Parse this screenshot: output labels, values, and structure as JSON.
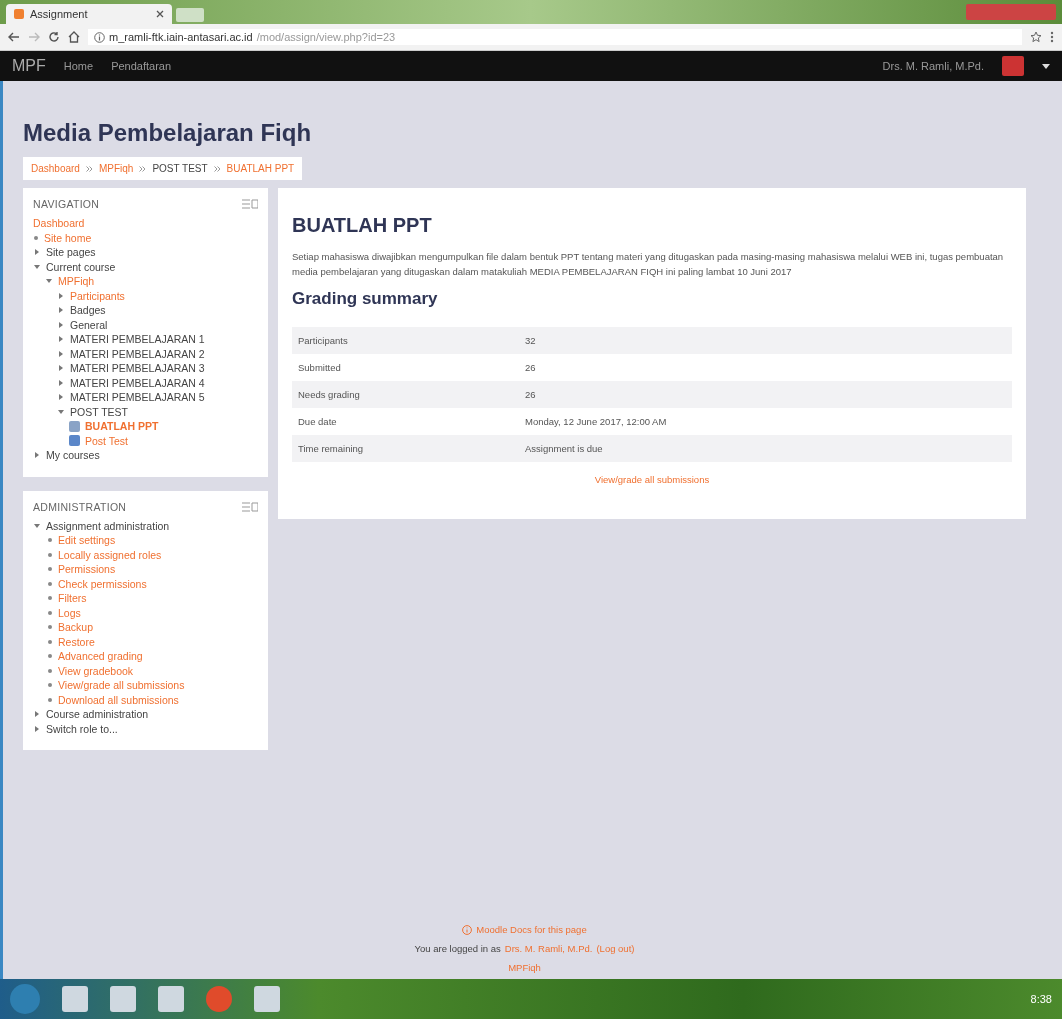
{
  "browser": {
    "tab_title": "Assignment",
    "url_host": "m_ramli-ftk.iain-antasari.ac.id",
    "url_path": "/mod/assign/view.php?id=23"
  },
  "navbar": {
    "brand": "MPF",
    "links": [
      "Home",
      "Pendaftaran"
    ],
    "user": "Drs. M. Ramli, M.Pd."
  },
  "page_title": "Media Pembelajaran Fiqh",
  "breadcrumb": [
    {
      "label": "Dashboard",
      "link": true
    },
    {
      "label": "MPFiqh",
      "link": true
    },
    {
      "label": "POST TEST",
      "link": false
    },
    {
      "label": "BUATLAH PPT",
      "link": true
    }
  ],
  "navigation": {
    "title": "NAVIGATION",
    "items": [
      {
        "label": "Dashboard",
        "link": true,
        "kind": "plain"
      },
      {
        "label": "Site home",
        "link": true,
        "kind": "bullet"
      },
      {
        "label": "Site pages",
        "link": false,
        "kind": "node",
        "expanded": false
      },
      {
        "label": "Current course",
        "link": false,
        "kind": "node",
        "expanded": true,
        "children": [
          {
            "label": "MPFiqh",
            "link": true,
            "kind": "node",
            "expanded": true,
            "children": [
              {
                "label": "Participants",
                "link": true,
                "kind": "node",
                "expanded": false
              },
              {
                "label": "Badges",
                "link": false,
                "kind": "node",
                "expanded": false
              },
              {
                "label": "General",
                "link": false,
                "kind": "node",
                "expanded": false
              },
              {
                "label": "MATERI PEMBELAJARAN 1",
                "link": false,
                "kind": "node",
                "expanded": false
              },
              {
                "label": "MATERI PEMBELAJARAN 2",
                "link": false,
                "kind": "node",
                "expanded": false
              },
              {
                "label": "MATERI PEMBELAJARAN 3",
                "link": false,
                "kind": "node",
                "expanded": false
              },
              {
                "label": "MATERI PEMBELAJARAN 4",
                "link": false,
                "kind": "node",
                "expanded": false
              },
              {
                "label": "MATERI PEMBELAJARAN 5",
                "link": false,
                "kind": "node",
                "expanded": false
              },
              {
                "label": "POST TEST",
                "link": false,
                "kind": "node",
                "expanded": true,
                "children": [
                  {
                    "label": "BUATLAH PPT",
                    "link": true,
                    "kind": "assignment",
                    "selected": true
                  },
                  {
                    "label": "Post Test",
                    "link": true,
                    "kind": "quiz",
                    "selected": false
                  }
                ]
              }
            ]
          }
        ]
      },
      {
        "label": "My courses",
        "link": false,
        "kind": "node",
        "expanded": false
      }
    ]
  },
  "administration": {
    "title": "ADMINISTRATION",
    "sections": [
      {
        "label": "Assignment administration",
        "expanded": true,
        "items": [
          "Edit settings",
          "Locally assigned roles",
          "Permissions",
          "Check permissions",
          "Filters",
          "Logs",
          "Backup",
          "Restore",
          "Advanced grading",
          "View gradebook",
          "View/grade all submissions",
          "Download all submissions"
        ]
      },
      {
        "label": "Course administration",
        "expanded": false
      },
      {
        "label": "Switch role to...",
        "expanded": false
      }
    ]
  },
  "assignment": {
    "title": "BUATLAH PPT",
    "description": "Setiap mahasiswa diwajibkan mengumpulkan file dalam bentuk PPT tentang materi yang ditugaskan pada masing-masing mahasiswa melalui WEB ini, tugas pembuatan media pembelajaran yang ditugaskan dalam matakuliah MEDIA PEMBELAJARAN FIQH ini paling lambat 10 Juni 2017",
    "summary_title": "Grading summary",
    "summary": [
      {
        "label": "Participants",
        "value": "32"
      },
      {
        "label": "Submitted",
        "value": "26"
      },
      {
        "label": "Needs grading",
        "value": "26"
      },
      {
        "label": "Due date",
        "value": "Monday, 12 June 2017, 12:00 AM"
      },
      {
        "label": "Time remaining",
        "value": "Assignment is due"
      }
    ],
    "link": "View/grade all submissions"
  },
  "footer": {
    "docs_link": "Moodle Docs for this page",
    "logged_in_prefix": "You are logged in as",
    "user": "Drs. M. Ramli, M.Pd.",
    "logout": "(Log out)",
    "course": "MPFiqh"
  },
  "taskbar": {
    "time": "8:38"
  }
}
